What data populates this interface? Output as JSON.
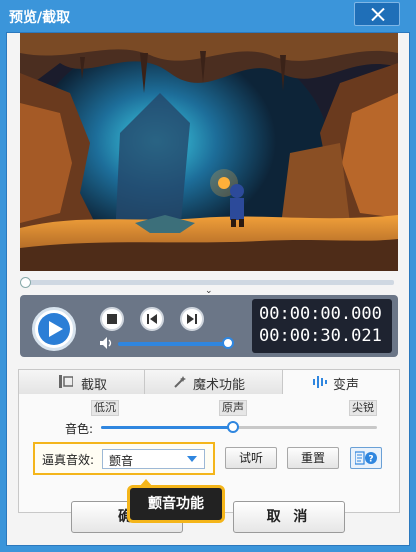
{
  "window": {
    "title": "预览/截取",
    "close_icon": "close-icon"
  },
  "player": {
    "current_time": "00:00:00.000",
    "total_time": "00:00:30.021",
    "icons": [
      "play-icon",
      "stop-icon",
      "previous-frame-icon",
      "next-frame-icon",
      "volume-icon",
      "chevron-down-icon"
    ]
  },
  "tabs": [
    {
      "label": "截取",
      "icon": "trim-icon",
      "active": false
    },
    {
      "label": "魔术功能",
      "icon": "magic-icon",
      "active": false
    },
    {
      "label": "变声",
      "icon": "voice-wave-icon",
      "active": true
    }
  ],
  "voice": {
    "scale_low": "低沉",
    "scale_mid": "原声",
    "scale_high": "尖锐",
    "tone_label": "音色:",
    "effect_label": "逼真音效:",
    "effect_value": "颤音",
    "preview_button": "试听",
    "reset_button": "重置",
    "help_icon": "help-icon"
  },
  "buttons": {
    "ok_label": "确",
    "cancel_label": "取 消"
  },
  "callout": {
    "text": "颤音功能"
  },
  "colors": {
    "accent": "#2f86df",
    "title_bar": "#3b95da",
    "highlight": "#f4b51a"
  }
}
